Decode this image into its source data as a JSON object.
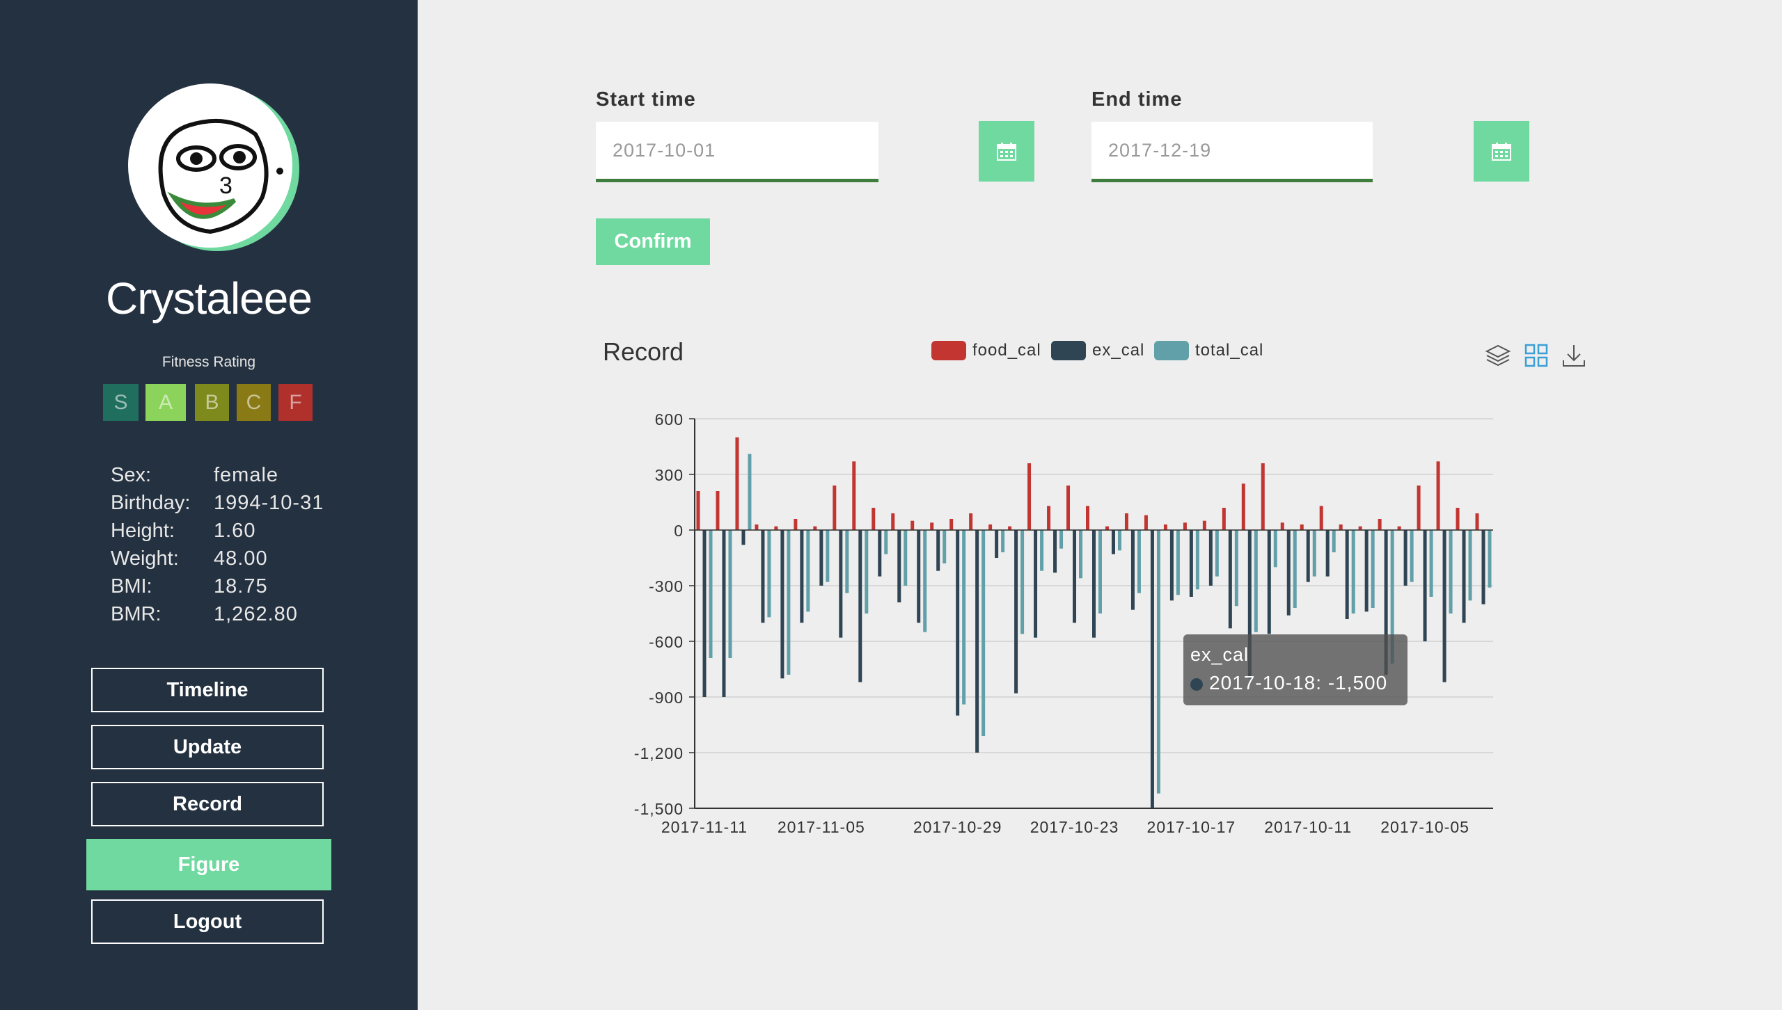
{
  "profile": {
    "username": "Crystaleee",
    "fitness_rating_label": "Fitness Rating",
    "ratings": [
      {
        "label": "S",
        "color": "#1f6e5e"
      },
      {
        "label": "A",
        "color": "#8bd35a",
        "selected": true
      },
      {
        "label": "B",
        "color": "#7f8a1c"
      },
      {
        "label": "C",
        "color": "#8a7a16"
      },
      {
        "label": "F",
        "color": "#b0302c"
      }
    ],
    "info": [
      {
        "label": "Sex:",
        "value": "female"
      },
      {
        "label": "Birthday:",
        "value": "1994-10-31"
      },
      {
        "label": "Height:",
        "value": "1.60"
      },
      {
        "label": "Weight:",
        "value": "48.00"
      },
      {
        "label": "BMI:",
        "value": "18.75"
      },
      {
        "label": "BMR:",
        "value": "1,262.80"
      }
    ]
  },
  "nav": {
    "items": [
      {
        "label": "Timeline",
        "active": false
      },
      {
        "label": "Update",
        "active": false
      },
      {
        "label": "Record",
        "active": false
      },
      {
        "label": "Figure",
        "active": true
      },
      {
        "label": "Logout",
        "active": false
      }
    ]
  },
  "filters": {
    "start_label": "Start time",
    "start_value": "2017-10-01",
    "end_label": "End time",
    "end_value": "2017-12-19",
    "confirm_label": "Confirm",
    "calendar_icon": "calendar-icon"
  },
  "toolbox": {
    "icons": [
      "layers-icon",
      "grid-icon",
      "download-icon"
    ]
  },
  "colors": {
    "accent": "#6fd9a0",
    "sidebar": "#243140",
    "food_cal": "#c23531",
    "ex_cal": "#2f4554",
    "total_cal": "#61a0a8"
  },
  "tooltip": {
    "series": "ex_cal",
    "text": "2017-10-18: -1,500"
  },
  "chart_data": {
    "type": "bar",
    "title": "Record",
    "ylim": [
      -1500,
      600
    ],
    "yticks": [
      600,
      300,
      0,
      -300,
      -600,
      -900,
      -1200,
      -1500
    ],
    "ytick_labels": [
      "600",
      "300",
      "0",
      "-300",
      "-600",
      "-900",
      "-1,200",
      "-1,500"
    ],
    "xtick_labels": [
      "2017-11-11",
      "2017-11-05",
      "2017-10-29",
      "2017-10-23",
      "2017-10-17",
      "2017-10-11",
      "2017-10-05"
    ],
    "grid": true,
    "legend_position": "top-center",
    "categories": [
      "2017-11-11",
      "2017-11-10",
      "2017-11-09",
      "2017-11-08",
      "2017-11-07",
      "2017-11-06",
      "2017-11-05",
      "2017-11-04",
      "2017-11-03",
      "2017-11-02",
      "2017-11-01",
      "2017-10-31",
      "2017-10-30",
      "2017-10-29",
      "2017-10-28",
      "2017-10-27",
      "2017-10-26",
      "2017-10-25",
      "2017-10-24",
      "2017-10-23",
      "2017-10-22",
      "2017-10-21",
      "2017-10-20",
      "2017-10-19",
      "2017-10-18",
      "2017-10-17",
      "2017-10-16",
      "2017-10-15",
      "2017-10-14",
      "2017-10-13",
      "2017-10-12",
      "2017-10-11",
      "2017-10-10",
      "2017-10-09",
      "2017-10-08",
      "2017-10-07",
      "2017-10-06",
      "2017-10-05",
      "2017-10-04",
      "2017-10-03",
      "2017-10-02"
    ],
    "series": [
      {
        "name": "food_cal",
        "values": [
          210,
          210,
          500,
          30,
          20,
          60,
          20,
          240,
          370,
          120,
          90,
          50,
          40,
          60,
          90,
          30,
          20,
          360,
          130,
          240,
          130,
          20,
          90,
          80,
          30,
          40,
          50,
          120,
          250,
          360,
          40,
          30,
          130,
          30,
          20,
          60,
          20,
          240,
          370,
          120,
          90
        ]
      },
      {
        "name": "ex_cal",
        "values": [
          -900,
          -900,
          -80,
          -500,
          -800,
          -500,
          -300,
          -580,
          -820,
          -250,
          -390,
          -500,
          -220,
          -1000,
          -1200,
          -150,
          -880,
          -580,
          -230,
          -500,
          -580,
          -130,
          -430,
          -1500,
          -380,
          -360,
          -300,
          -530,
          -800,
          -560,
          -460,
          -280,
          -250,
          -480,
          -440,
          -780,
          -300,
          -600,
          -820,
          -500,
          -400
        ]
      },
      {
        "name": "total_cal",
        "values": [
          -690,
          -690,
          410,
          -470,
          -780,
          -440,
          -280,
          -340,
          -450,
          -130,
          -300,
          -550,
          -180,
          -940,
          -1110,
          -120,
          -560,
          -220,
          -100,
          -260,
          -450,
          -110,
          -340,
          -1420,
          -350,
          -320,
          -250,
          -410,
          -550,
          -200,
          -420,
          -250,
          -120,
          -450,
          -420,
          -720,
          -280,
          -360,
          -450,
          -380,
          -310
        ]
      }
    ]
  }
}
